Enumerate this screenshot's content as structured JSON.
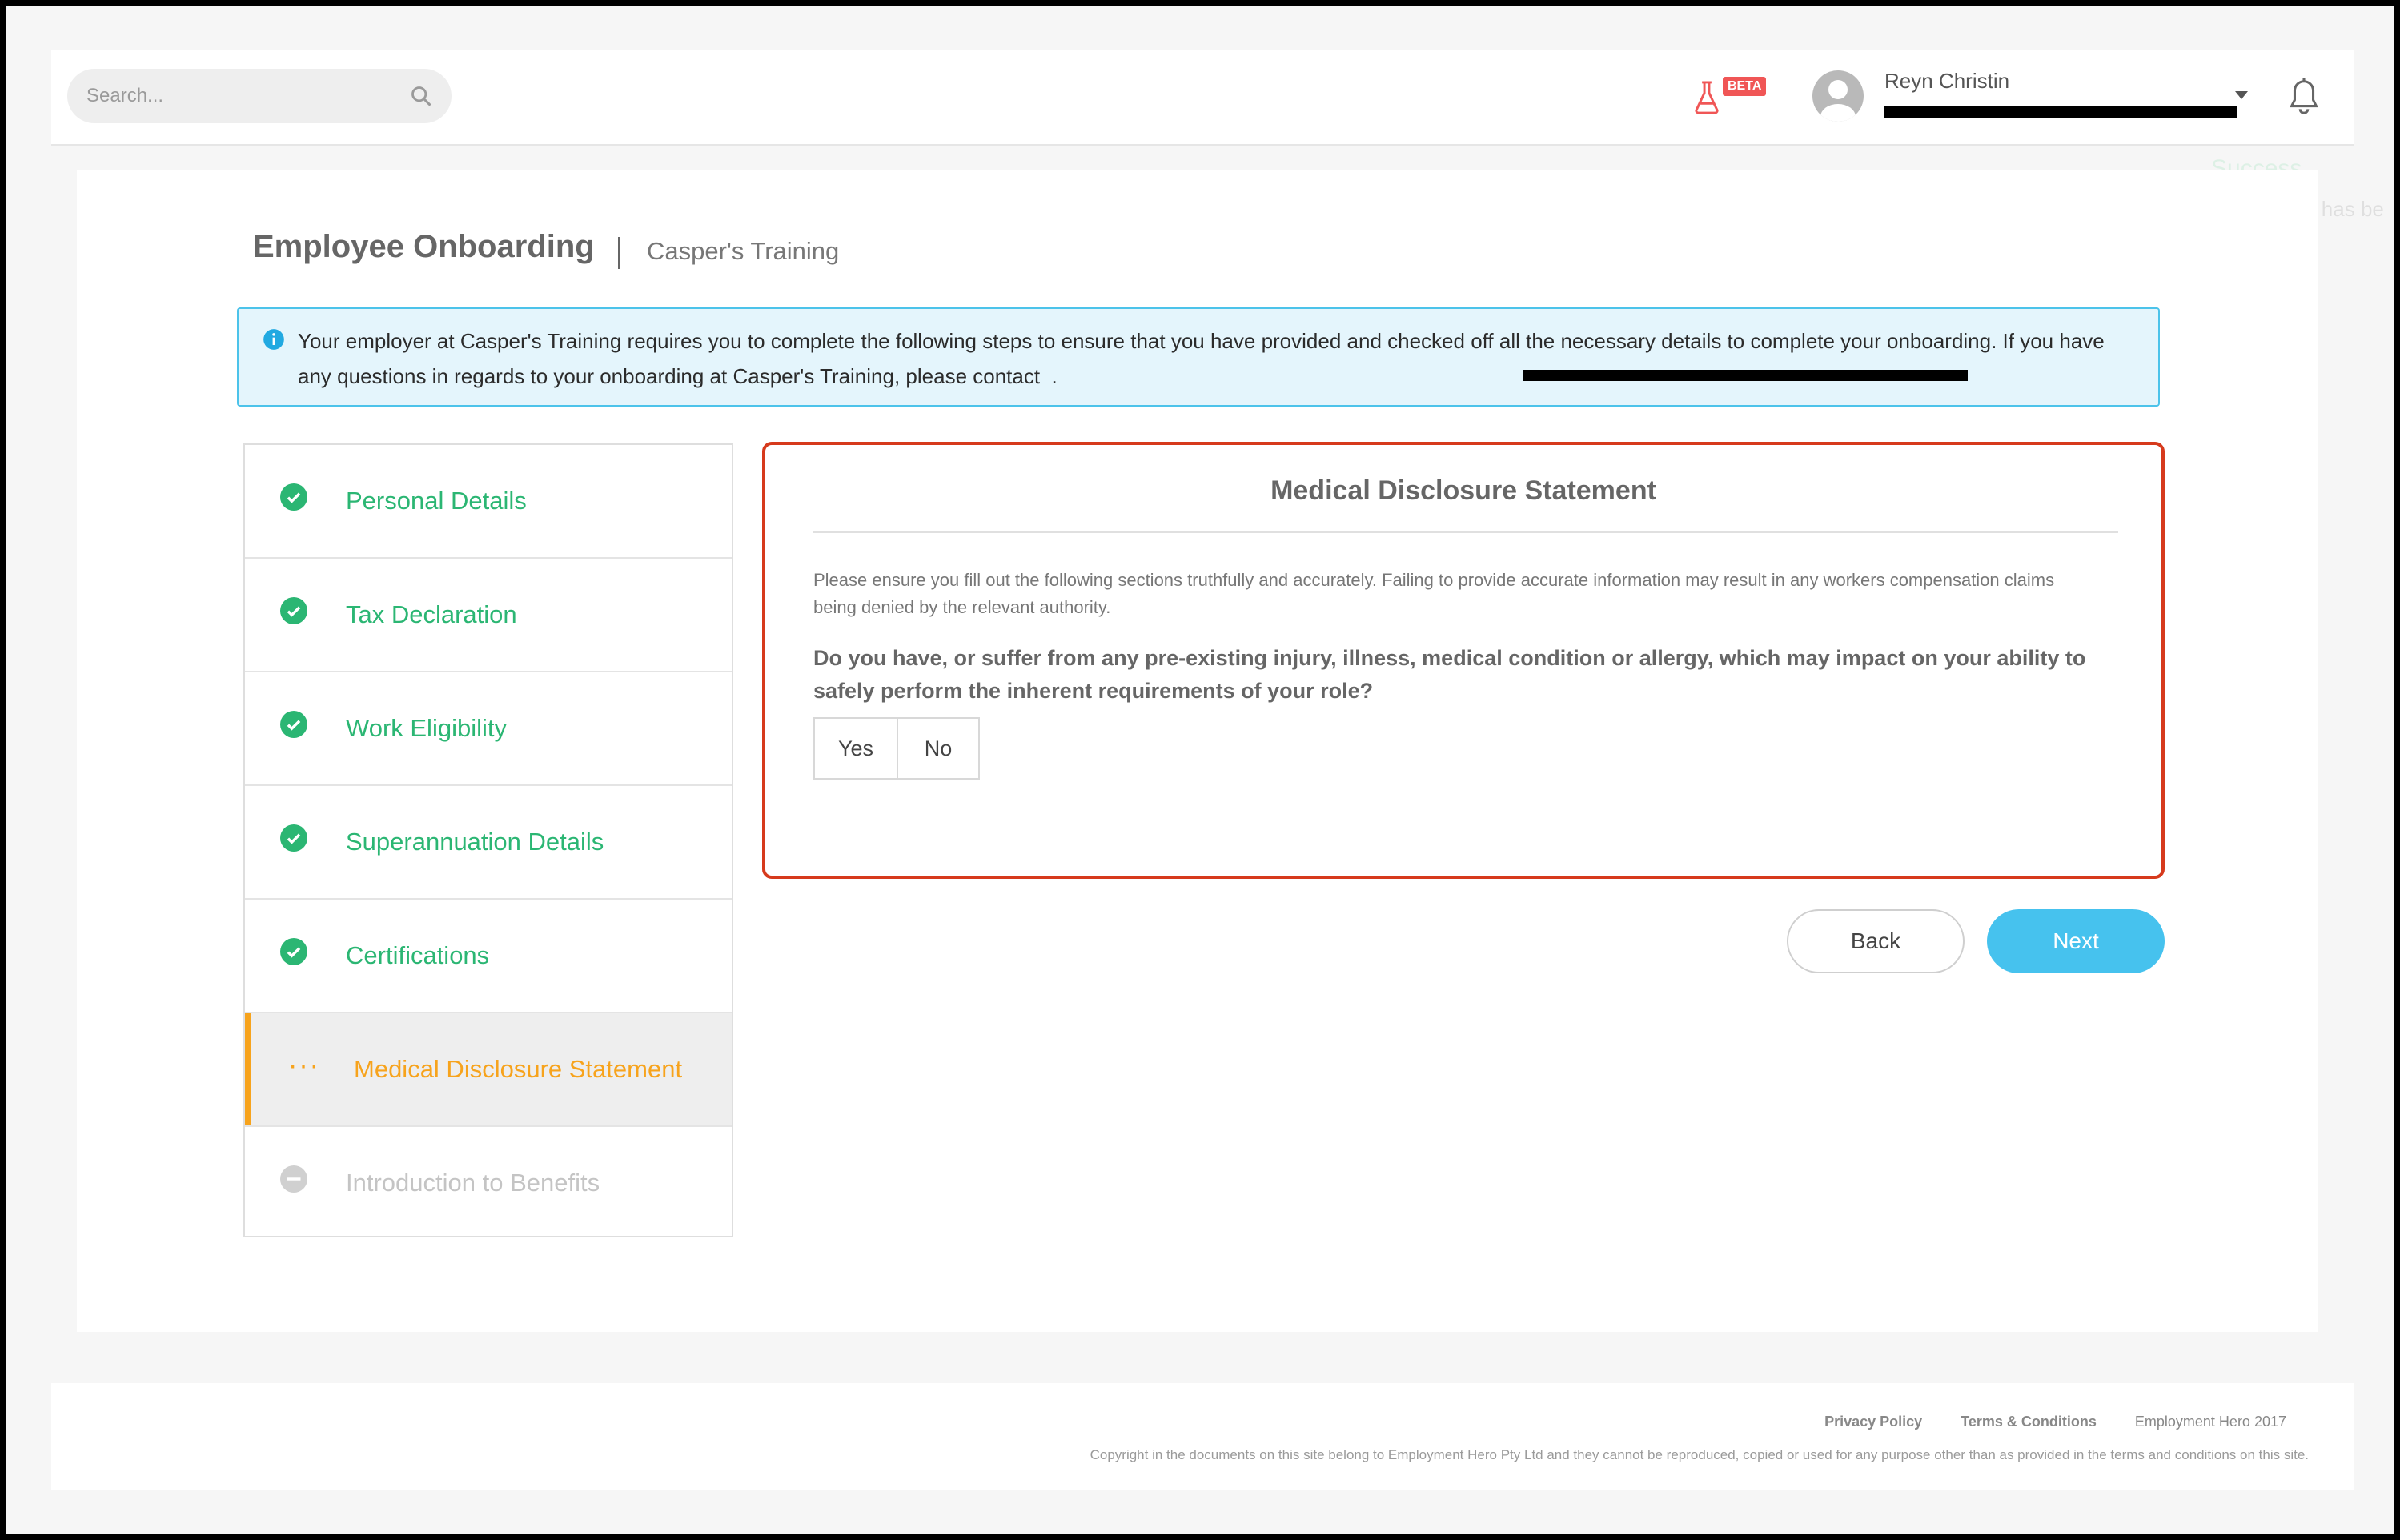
{
  "header": {
    "search_placeholder": "Search...",
    "beta_label": "BETA",
    "user_name": "Reyn Christin",
    "toast": {
      "title": "Success",
      "message": "Your profile has be"
    }
  },
  "page": {
    "title": "Employee Onboarding",
    "subtitle": "Casper's Training",
    "info_text": "Your employer at Casper's Training requires you to complete the following steps to ensure that you have provided and checked off all the necessary details to complete your onboarding. If you have any questions in regards to your onboarding at Casper's Training, please contact ",
    "info_contact_suffix": "."
  },
  "steps": [
    {
      "label": "Personal Details",
      "status": "complete"
    },
    {
      "label": "Tax Declaration",
      "status": "complete"
    },
    {
      "label": "Work Eligibility",
      "status": "complete"
    },
    {
      "label": "Superannuation Details",
      "status": "complete"
    },
    {
      "label": "Certifications",
      "status": "complete"
    },
    {
      "label": "Medical Disclosure Statement",
      "status": "in-progress"
    },
    {
      "label": "Introduction to Benefits",
      "status": "pending"
    }
  ],
  "panel": {
    "title": "Medical Disclosure Statement",
    "description": "Please ensure you fill out the following sections truthfully and accurately. Failing to provide accurate information may result in any workers compensation claims being denied by the relevant authority.",
    "question": "Do you have, or suffer from any pre-existing injury, illness, medical condition or allergy, which may impact on your ability to safely perform the inherent requirements of your role?",
    "yes_label": "Yes",
    "no_label": "No"
  },
  "actions": {
    "back_label": "Back",
    "next_label": "Next"
  },
  "footer": {
    "privacy": "Privacy Policy",
    "terms": "Terms & Conditions",
    "brand": "Employment Hero 2017",
    "copyright": "Copyright in the documents on this site belong to Employment Hero Pty Ltd and they cannot be reproduced, copied or used for any purpose other than as provided in the terms and conditions on this site."
  },
  "colors": {
    "complete": "#2bb673",
    "active": "#f7a31c",
    "pending": "#c4c4c4",
    "primary": "#46c2ee",
    "panel_border": "#d63a1d"
  }
}
